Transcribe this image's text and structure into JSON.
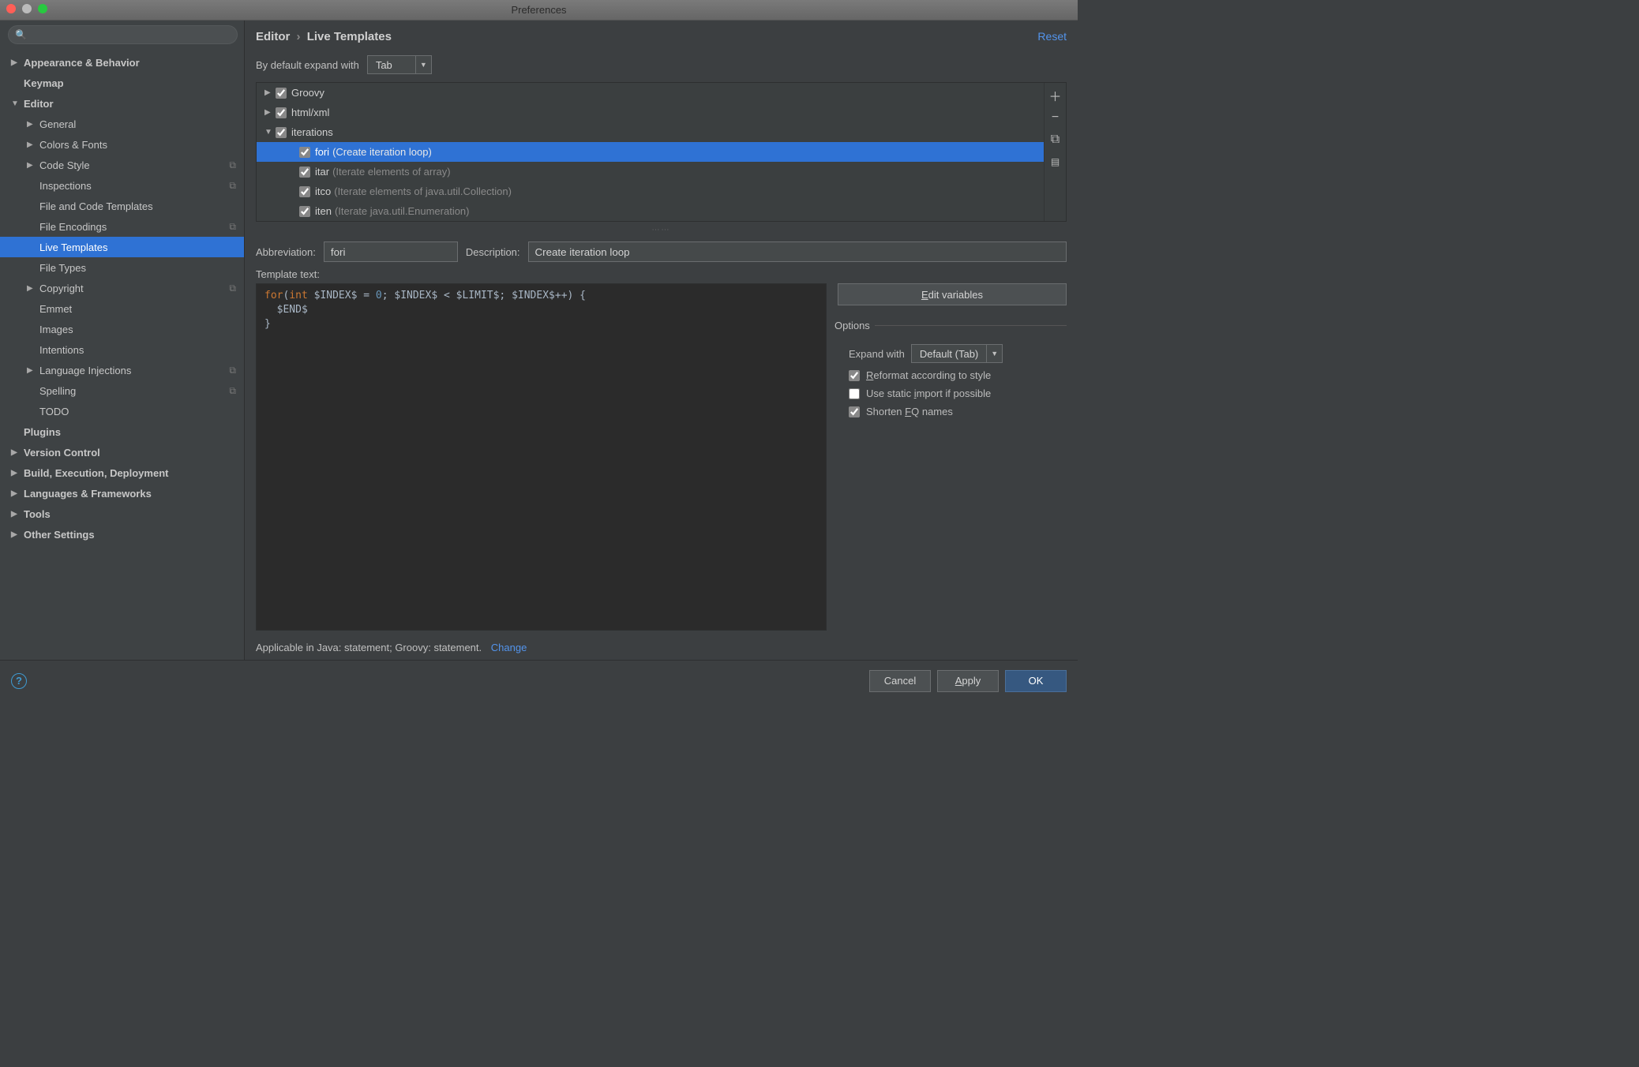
{
  "window_title": "Preferences",
  "breadcrumb": {
    "parent": "Editor",
    "current": "Live Templates"
  },
  "reset_label": "Reset",
  "sidebar": {
    "items": [
      {
        "label": "Appearance & Behavior",
        "level": 0,
        "arrow": "▶",
        "bold": true
      },
      {
        "label": "Keymap",
        "level": 0,
        "arrow": "",
        "bold": true
      },
      {
        "label": "Editor",
        "level": 0,
        "arrow": "▼",
        "bold": true
      },
      {
        "label": "General",
        "level": 1,
        "arrow": "▶"
      },
      {
        "label": "Colors & Fonts",
        "level": 1,
        "arrow": "▶"
      },
      {
        "label": "Code Style",
        "level": 1,
        "arrow": "▶",
        "tag": "⧉"
      },
      {
        "label": "Inspections",
        "level": 1,
        "arrow": "",
        "tag": "⧉"
      },
      {
        "label": "File and Code Templates",
        "level": 1,
        "arrow": ""
      },
      {
        "label": "File Encodings",
        "level": 1,
        "arrow": "",
        "tag": "⧉"
      },
      {
        "label": "Live Templates",
        "level": 1,
        "arrow": "",
        "selected": true
      },
      {
        "label": "File Types",
        "level": 1,
        "arrow": ""
      },
      {
        "label": "Copyright",
        "level": 1,
        "arrow": "▶",
        "tag": "⧉"
      },
      {
        "label": "Emmet",
        "level": 1,
        "arrow": ""
      },
      {
        "label": "Images",
        "level": 1,
        "arrow": ""
      },
      {
        "label": "Intentions",
        "level": 1,
        "arrow": ""
      },
      {
        "label": "Language Injections",
        "level": 1,
        "arrow": "▶",
        "tag": "⧉"
      },
      {
        "label": "Spelling",
        "level": 1,
        "arrow": "",
        "tag": "⧉"
      },
      {
        "label": "TODO",
        "level": 1,
        "arrow": ""
      },
      {
        "label": "Plugins",
        "level": 0,
        "arrow": "",
        "bold": true
      },
      {
        "label": "Version Control",
        "level": 0,
        "arrow": "▶",
        "bold": true
      },
      {
        "label": "Build, Execution, Deployment",
        "level": 0,
        "arrow": "▶",
        "bold": true
      },
      {
        "label": "Languages & Frameworks",
        "level": 0,
        "arrow": "▶",
        "bold": true
      },
      {
        "label": "Tools",
        "level": 0,
        "arrow": "▶",
        "bold": true
      },
      {
        "label": "Other Settings",
        "level": 0,
        "arrow": "▶",
        "bold": true
      }
    ]
  },
  "default_expand": {
    "label": "By default expand with",
    "value": "Tab"
  },
  "templates": {
    "groups": [
      {
        "name": "Groovy",
        "expanded": false
      },
      {
        "name": "html/xml",
        "expanded": false
      },
      {
        "name": "iterations",
        "expanded": true,
        "children": [
          {
            "name": "fori",
            "desc": "(Create iteration loop)",
            "selected": true
          },
          {
            "name": "itar",
            "desc": "(Iterate elements of array)"
          },
          {
            "name": "itco",
            "desc": "(Iterate elements of java.util.Collection)"
          },
          {
            "name": "iten",
            "desc": "(Iterate java.util.Enumeration)"
          }
        ]
      }
    ]
  },
  "detail": {
    "abbrev_label": "Abbreviation:",
    "abbrev_value": "fori",
    "desc_label": "Description:",
    "desc_value": "Create iteration loop",
    "template_text_label": "Template text:",
    "edit_vars_label": "Edit variables",
    "options_title": "Options",
    "expand_with_label": "Expand with",
    "expand_with_value": "Default (Tab)",
    "reformat_label": "Reformat according to style",
    "static_import_label": "Use static import if possible",
    "shorten_fq_label": "Shorten FQ names",
    "applicable_text": "Applicable in Java: statement; Groovy: statement.",
    "change_label": "Change"
  },
  "footer": {
    "cancel": "Cancel",
    "apply": "Apply",
    "ok": "OK"
  }
}
